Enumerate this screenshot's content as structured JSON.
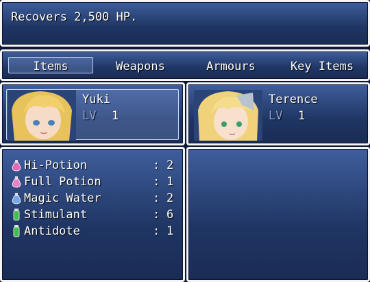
{
  "help": {
    "text": "Recovers 2,500 HP."
  },
  "tabs": [
    {
      "label": "Items",
      "selected": true
    },
    {
      "label": "Weapons"
    },
    {
      "label": "Armours"
    },
    {
      "label": "Key Items"
    }
  ],
  "actors": [
    {
      "name": "Yuki",
      "lv_label": "LV",
      "level": "1",
      "selected": true,
      "hair": "#e8c25a"
    },
    {
      "name": "Terence",
      "lv_label": "LV",
      "level": "1",
      "selected": false,
      "hair": "#f0d27a"
    }
  ],
  "items": [
    {
      "name": "Hi-Potion",
      "qty": "2",
      "icon": "pink-potion-icon",
      "color": "#e06ab8"
    },
    {
      "name": "Full Potion",
      "qty": "1",
      "icon": "pink-potion-icon",
      "color": "#e883c8"
    },
    {
      "name": "Magic Water",
      "qty": "2",
      "icon": "blue-potion-icon",
      "color": "#7aa6e8"
    },
    {
      "name": "Stimulant",
      "qty": "6",
      "icon": "green-bottle-icon",
      "color": "#3fbf4a"
    },
    {
      "name": "Antidote",
      "qty": "1",
      "icon": "green-bottle-icon",
      "color": "#3fbf4a"
    }
  ],
  "item_separator": ":"
}
